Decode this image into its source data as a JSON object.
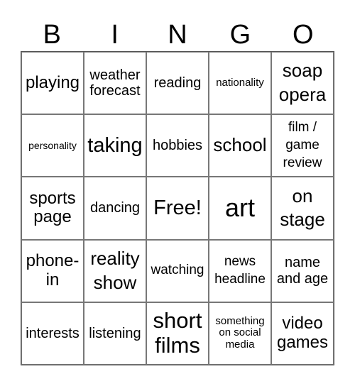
{
  "title_letters": [
    "B",
    "I",
    "N",
    "G",
    "O"
  ],
  "cells": [
    [
      "playing",
      "weather forecast",
      "reading",
      "nationality",
      "soap opera"
    ],
    [
      "personality",
      "taking",
      "hobbies",
      "school",
      "film / game review"
    ],
    [
      "sports page",
      "dancing",
      "Free!",
      "art",
      "on stage"
    ],
    [
      "phone-in",
      "reality show",
      "watching",
      "news headline",
      "name and age"
    ],
    [
      "interests",
      "listening",
      "short films",
      "something on social media",
      "video games"
    ]
  ]
}
